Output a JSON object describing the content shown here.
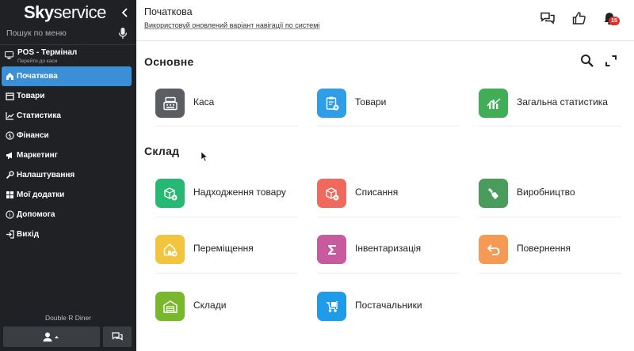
{
  "app": {
    "logo_bold": "Sky",
    "logo_light": "service",
    "search_placeholder": "Пошук по меню"
  },
  "pos": {
    "title": "POS - Термінал",
    "subtitle": "Перейти до каси"
  },
  "sidebar": {
    "items": [
      {
        "label": "Початкова",
        "icon": "home-icon",
        "active": true
      },
      {
        "label": "Товари",
        "icon": "box-icon"
      },
      {
        "label": "Статистика",
        "icon": "chart-icon"
      },
      {
        "label": "Фінанси",
        "icon": "dollar-icon"
      },
      {
        "label": "Маркетинг",
        "icon": "megaphone-icon"
      },
      {
        "label": "Налаштування",
        "icon": "wrench-icon"
      },
      {
        "label": "Мої додатки",
        "icon": "grid-icon"
      },
      {
        "label": "Допомога",
        "icon": "help-icon"
      },
      {
        "label": "Вихід",
        "icon": "exit-icon"
      }
    ],
    "restaurant": "Double R Diner",
    "accent": "#3b8fd6"
  },
  "header": {
    "title": "Початкова",
    "notice": "Використовуй оновлений варіант навігації по системі",
    "notifications_count": "15"
  },
  "sections": {
    "main": {
      "title": "Основне",
      "tiles": [
        {
          "label": "Каса",
          "icon": "cash-register-icon",
          "color": "#5a5d62"
        },
        {
          "label": "Товари",
          "icon": "goods-icon",
          "color": "#2e9fe6"
        },
        {
          "label": "Загальна статистика",
          "icon": "statistics-icon",
          "color": "#3fae57"
        }
      ]
    },
    "warehouse": {
      "title": "Склад",
      "tiles": [
        {
          "label": "Надходження товару",
          "icon": "incoming-goods-icon",
          "color": "#27b973"
        },
        {
          "label": "Списання",
          "icon": "write-off-icon",
          "color": "#ef6a5d"
        },
        {
          "label": "Виробництво",
          "icon": "production-icon",
          "color": "#4a9c5d"
        },
        {
          "label": "Переміщення",
          "icon": "transfer-icon",
          "color": "#f3c43d"
        },
        {
          "label": "Інвентаризація",
          "icon": "inventory-icon",
          "color": "#c85a9e"
        },
        {
          "label": "Повернення",
          "icon": "return-icon",
          "color": "#f59a55"
        },
        {
          "label": "Склади",
          "icon": "warehouse-icon",
          "color": "#79b82d"
        },
        {
          "label": "Постачальники",
          "icon": "suppliers-icon",
          "color": "#1f9be8"
        }
      ]
    }
  }
}
